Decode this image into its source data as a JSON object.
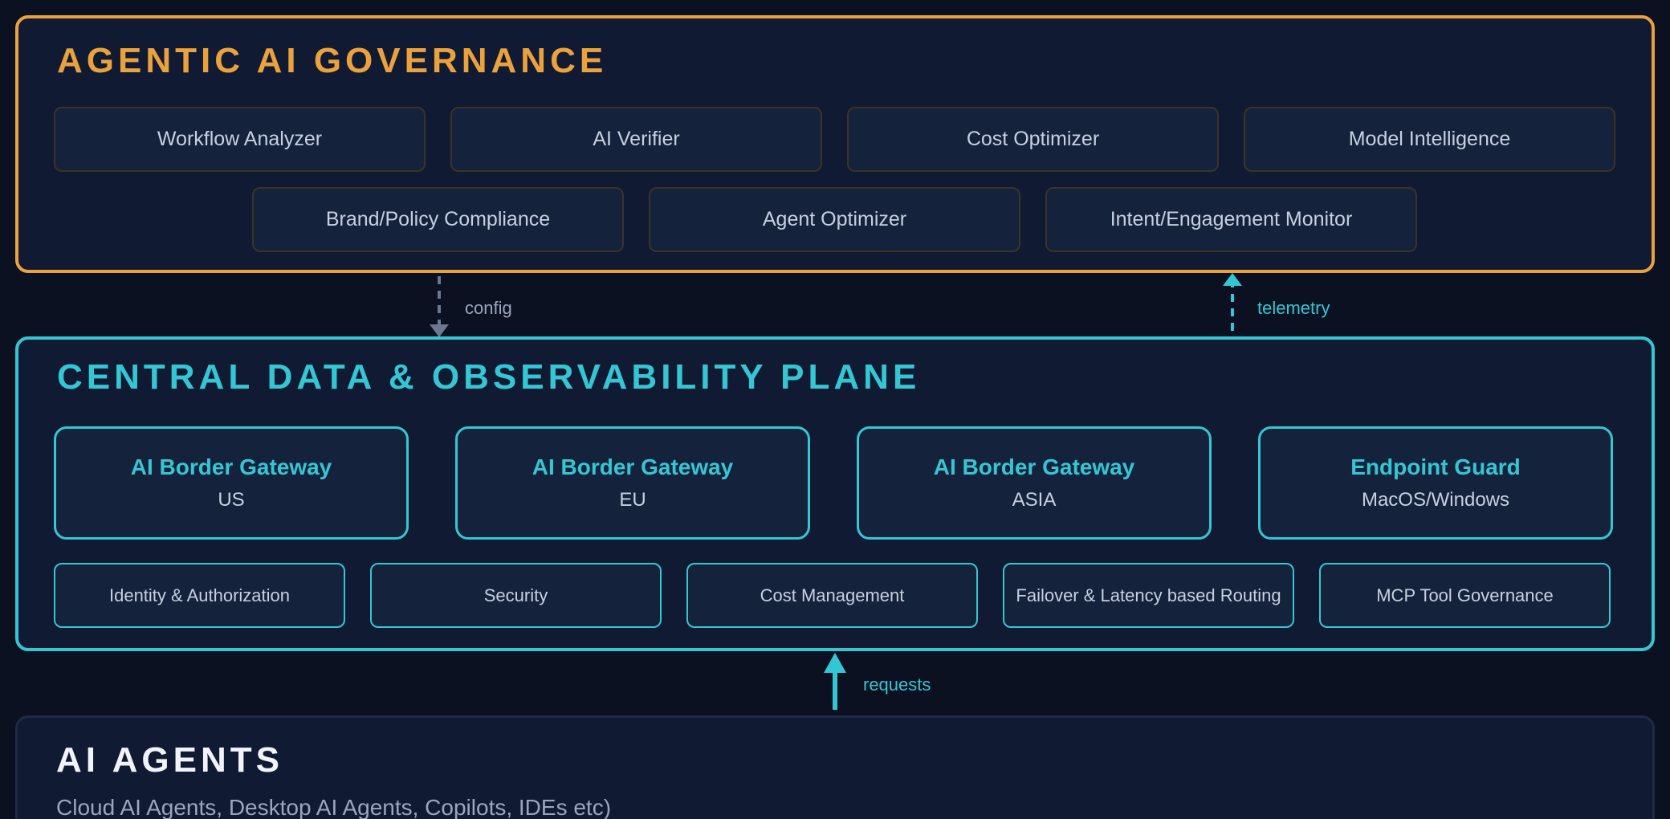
{
  "governance": {
    "title": "AGENTIC AI GOVERNANCE",
    "modules": [
      "Workflow Analyzer",
      "AI Verifier",
      "Cost Optimizer",
      "Model Intelligence",
      "Brand/Policy Compliance",
      "Agent Optimizer",
      "Intent/Engagement Monitor"
    ]
  },
  "connectors": {
    "config": "config",
    "telemetry": "telemetry",
    "requests": "requests"
  },
  "plane": {
    "title": "CENTRAL DATA & OBSERVABILITY PLANE",
    "gateways": [
      {
        "title": "AI Border Gateway",
        "subtitle": "US"
      },
      {
        "title": "AI Border Gateway",
        "subtitle": "EU"
      },
      {
        "title": "AI Border Gateway",
        "subtitle": "ASIA"
      },
      {
        "title": "Endpoint Guard",
        "subtitle": "MacOS/Windows"
      }
    ],
    "services": [
      "Identity & Authorization",
      "Security",
      "Cost Management",
      "Failover & Latency based Routing",
      "MCP Tool Governance"
    ]
  },
  "agents": {
    "title": "AI AGENTS",
    "description": "Cloud AI Agents, Desktop AI Agents, Copilots, IDEs etc)"
  },
  "colors": {
    "governance_accent": "#eba23c",
    "plane_accent": "#35c6d4",
    "config_arrow": "#6b7891",
    "background": "#0b1120"
  }
}
